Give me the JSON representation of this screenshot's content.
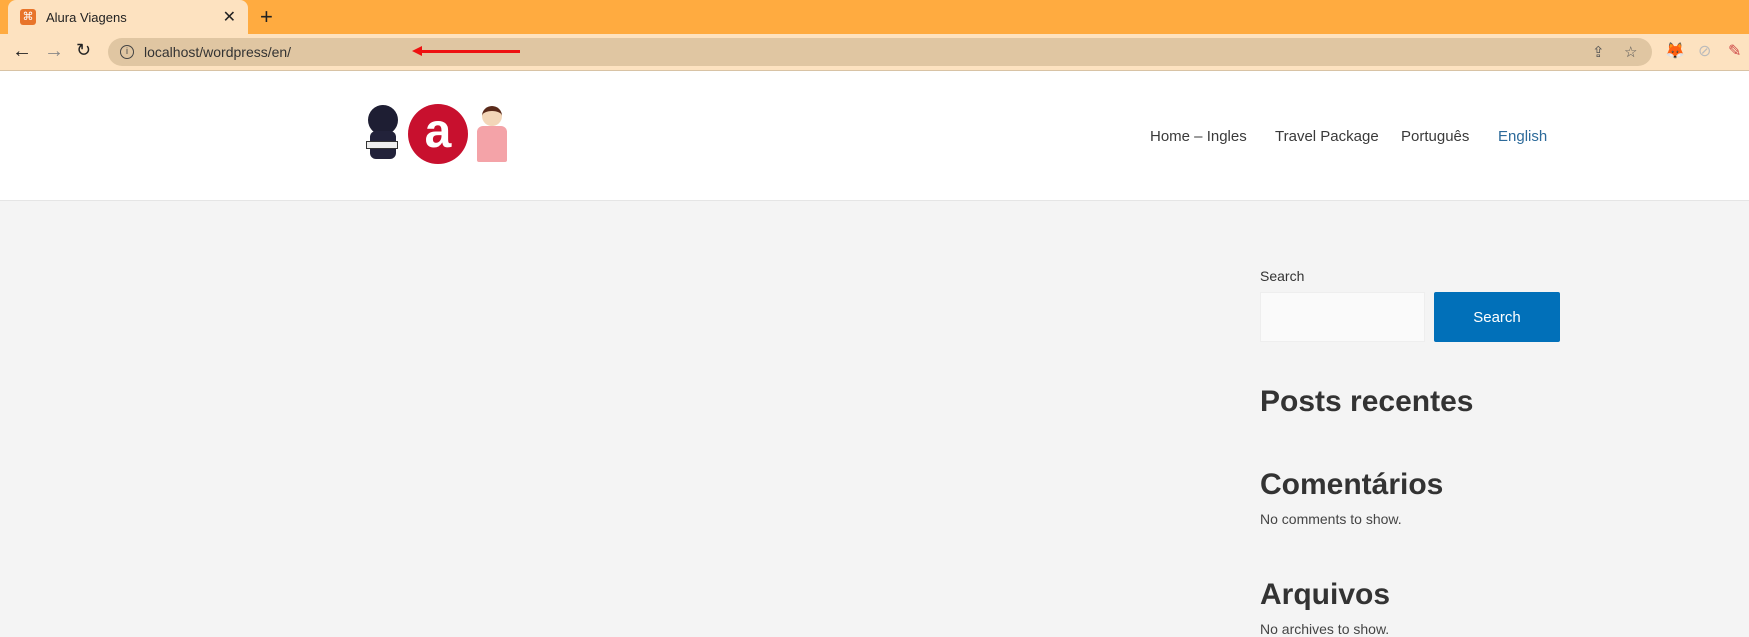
{
  "browser": {
    "tab_title": "Alura Viagens",
    "close_glyph": "✕",
    "new_tab_glyph": "+",
    "url": "localhost/wordpress/en/",
    "icons": [
      "back-icon",
      "forward-icon",
      "reload-icon",
      "info-icon",
      "share-icon",
      "star-icon",
      "metamask-icon",
      "extension-icon",
      "eyedropper-icon"
    ],
    "annotation_color": "#ee1111"
  },
  "site": {
    "logo_letter": "a",
    "menu": [
      {
        "label": "Home – Ingles"
      },
      {
        "label": "Travel Package"
      },
      {
        "label": "Português"
      },
      {
        "label": "English",
        "active": true
      }
    ],
    "accent": "#0170b9"
  },
  "sidebar": {
    "search_label": "Search",
    "search_value": "",
    "search_button": "Search",
    "recent_posts_title": "Posts recentes",
    "comments_title": "Comentários",
    "comments_empty": "No comments to show.",
    "archives_title": "Arquivos",
    "archives_empty": "No archives to show."
  }
}
